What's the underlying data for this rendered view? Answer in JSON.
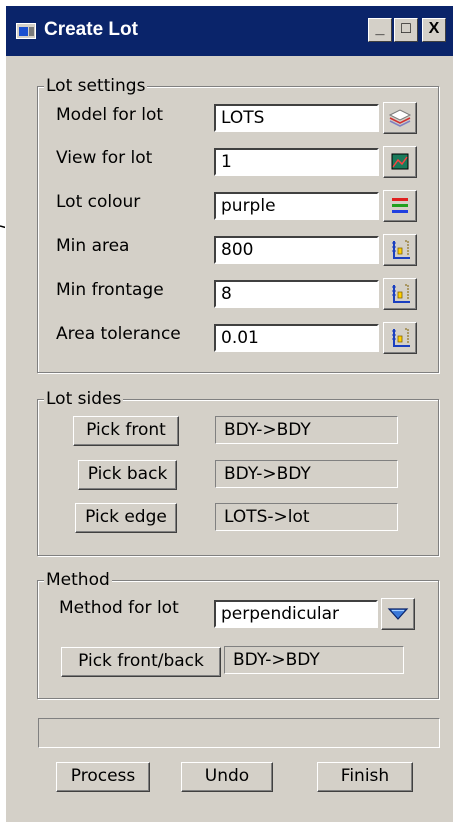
{
  "window": {
    "title": "Create Lot",
    "minimize_glyph": "_",
    "maximize_glyph": "□",
    "close_glyph": "X"
  },
  "lot_settings": {
    "legend": "Lot settings",
    "rows": [
      {
        "label": "Model for lot",
        "value": "LOTS",
        "icon": "layers-icon"
      },
      {
        "label": "View for lot",
        "value": "1",
        "icon": "view-icon"
      },
      {
        "label": "Lot colour",
        "value": "purple",
        "icon": "colour-icon"
      },
      {
        "label": "Min area",
        "value": "800",
        "icon": "calculator-icon"
      },
      {
        "label": "Min frontage",
        "value": "8",
        "icon": "calculator-icon"
      },
      {
        "label": "Area tolerance",
        "value": "0.01",
        "icon": "calculator-icon"
      }
    ]
  },
  "lot_sides": {
    "legend": "Lot sides",
    "rows": [
      {
        "button": "Pick front",
        "value": "BDY->BDY"
      },
      {
        "button": "Pick back",
        "value": "BDY->BDY"
      },
      {
        "button": "Pick edge",
        "value": "LOTS->lot"
      }
    ]
  },
  "method": {
    "legend": "Method",
    "label": "Method for lot",
    "value": "perpendicular",
    "dropdown_icon": "chevron-down-icon",
    "pick_button": "Pick front/back",
    "pick_value": "BDY->BDY"
  },
  "status": {
    "message": ""
  },
  "actions": {
    "process": "Process",
    "undo": "Undo",
    "finish": "Finish"
  },
  "colors": {
    "titlebar": "#0a246a",
    "dialog_bg": "#d4d0c8",
    "colour_icon_stripes": [
      "#e02020",
      "#20a020",
      "#2040e0"
    ]
  }
}
